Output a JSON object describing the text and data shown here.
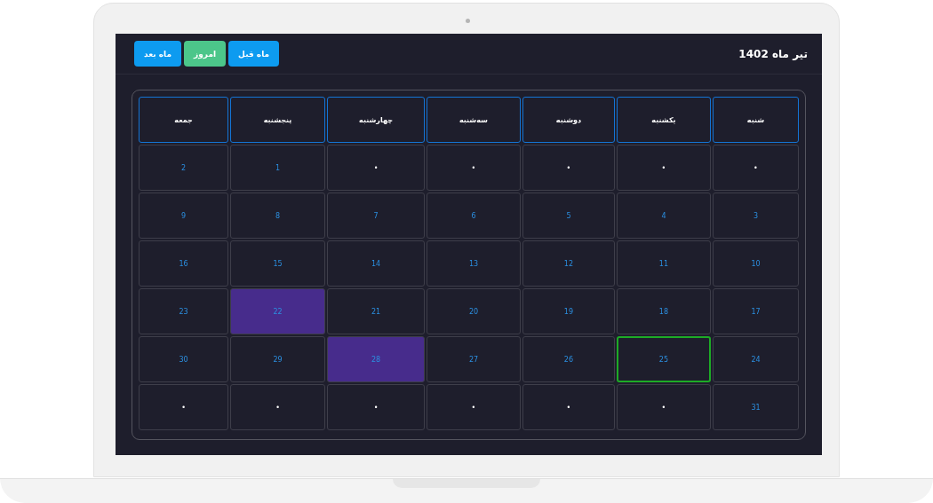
{
  "header": {
    "title": "تیر ماه 1402",
    "buttons": [
      {
        "label": "ماه قبل",
        "kind": "nav"
      },
      {
        "label": "امروز",
        "kind": "today"
      },
      {
        "label": "ماه بعد",
        "kind": "nav"
      }
    ]
  },
  "calendar": {
    "weekdays": [
      "شنبه",
      "یکشنبه",
      "دوشنبه",
      "سه‌شنبه",
      "چهارشنبه",
      "پنجشنبه",
      "جمعه"
    ],
    "weeks": [
      [
        {
          "kind": "empty",
          "text": "•",
          "selected": false,
          "today": false
        },
        {
          "kind": "empty",
          "text": "•",
          "selected": false,
          "today": false
        },
        {
          "kind": "empty",
          "text": "•",
          "selected": false,
          "today": false
        },
        {
          "kind": "empty",
          "text": "•",
          "selected": false,
          "today": false
        },
        {
          "kind": "empty",
          "text": "•",
          "selected": false,
          "today": false
        },
        {
          "kind": "day",
          "text": "1",
          "selected": false,
          "today": false
        },
        {
          "kind": "day",
          "text": "2",
          "selected": false,
          "today": false
        }
      ],
      [
        {
          "kind": "day",
          "text": "3",
          "selected": false,
          "today": false
        },
        {
          "kind": "day",
          "text": "4",
          "selected": false,
          "today": false
        },
        {
          "kind": "day",
          "text": "5",
          "selected": false,
          "today": false
        },
        {
          "kind": "day",
          "text": "6",
          "selected": false,
          "today": false
        },
        {
          "kind": "day",
          "text": "7",
          "selected": false,
          "today": false
        },
        {
          "kind": "day",
          "text": "8",
          "selected": false,
          "today": false
        },
        {
          "kind": "day",
          "text": "9",
          "selected": false,
          "today": false
        }
      ],
      [
        {
          "kind": "day",
          "text": "10",
          "selected": false,
          "today": false
        },
        {
          "kind": "day",
          "text": "11",
          "selected": false,
          "today": false
        },
        {
          "kind": "day",
          "text": "12",
          "selected": false,
          "today": false
        },
        {
          "kind": "day",
          "text": "13",
          "selected": false,
          "today": false
        },
        {
          "kind": "day",
          "text": "14",
          "selected": false,
          "today": false
        },
        {
          "kind": "day",
          "text": "15",
          "selected": false,
          "today": false
        },
        {
          "kind": "day",
          "text": "16",
          "selected": false,
          "today": false
        }
      ],
      [
        {
          "kind": "day",
          "text": "17",
          "selected": false,
          "today": false
        },
        {
          "kind": "day",
          "text": "18",
          "selected": false,
          "today": false
        },
        {
          "kind": "day",
          "text": "19",
          "selected": false,
          "today": false
        },
        {
          "kind": "day",
          "text": "20",
          "selected": false,
          "today": false
        },
        {
          "kind": "day",
          "text": "21",
          "selected": false,
          "today": false
        },
        {
          "kind": "day",
          "text": "22",
          "selected": true,
          "today": false
        },
        {
          "kind": "day",
          "text": "23",
          "selected": false,
          "today": false
        }
      ],
      [
        {
          "kind": "day",
          "text": "24",
          "selected": false,
          "today": false
        },
        {
          "kind": "day",
          "text": "25",
          "selected": false,
          "today": true
        },
        {
          "kind": "day",
          "text": "26",
          "selected": false,
          "today": false
        },
        {
          "kind": "day",
          "text": "27",
          "selected": false,
          "today": false
        },
        {
          "kind": "day",
          "text": "28",
          "selected": true,
          "today": false
        },
        {
          "kind": "day",
          "text": "29",
          "selected": false,
          "today": false
        },
        {
          "kind": "day",
          "text": "30",
          "selected": false,
          "today": false
        }
      ],
      [
        {
          "kind": "day",
          "text": "31",
          "selected": false,
          "today": false
        },
        {
          "kind": "empty",
          "text": "•",
          "selected": false,
          "today": false
        },
        {
          "kind": "empty",
          "text": "•",
          "selected": false,
          "today": false
        },
        {
          "kind": "empty",
          "text": "•",
          "selected": false,
          "today": false
        },
        {
          "kind": "empty",
          "text": "•",
          "selected": false,
          "today": false
        },
        {
          "kind": "empty",
          "text": "•",
          "selected": false,
          "today": false
        },
        {
          "kind": "empty",
          "text": "•",
          "selected": false,
          "today": false
        }
      ]
    ]
  }
}
